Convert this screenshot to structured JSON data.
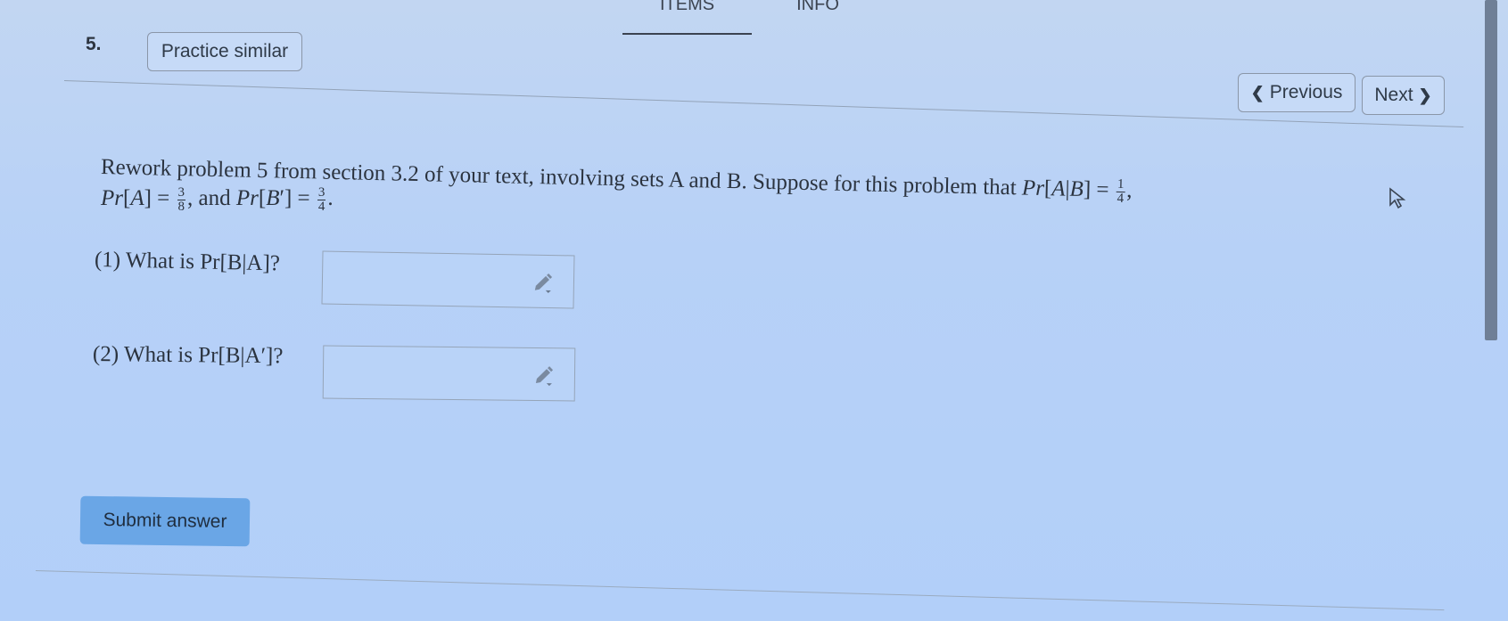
{
  "tabs": [
    {
      "label": "ITEMS",
      "active": true
    },
    {
      "label": "INFO",
      "active": false
    }
  ],
  "question": {
    "number": "5.",
    "practice_label": "Practice similar",
    "prev_label": "Previous",
    "next_label": "Next",
    "text_intro": "Rework problem 5 from section 3.2 of your text, involving sets A and B. Suppose for this problem that ",
    "given": {
      "pr_a_given_b": {
        "num": "1",
        "den": "4"
      },
      "pr_a": {
        "num": "3",
        "den": "8"
      },
      "pr_b_complement": {
        "num": "3",
        "den": "4"
      }
    },
    "parts": [
      {
        "label": "(1) What is Pr[B|A]?",
        "value": ""
      },
      {
        "label": "(2) What is Pr[B|A′]?",
        "value": ""
      }
    ],
    "submit_label": "Submit answer"
  },
  "icons": [
    "pencil-icon",
    "mouse-cursor-icon",
    "chevron-left-icon",
    "chevron-right-icon"
  ],
  "colors": {
    "background": "#b7d1f7",
    "submit_button": "#6aa6e6"
  }
}
